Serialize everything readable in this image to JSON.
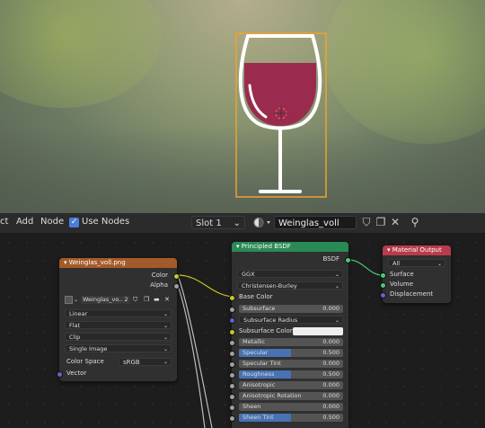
{
  "header": {
    "menu": [
      "ct",
      "Add",
      "Node"
    ],
    "use_nodes_label": "Use Nodes",
    "use_nodes_checked": true,
    "slot_label": "Slot 1",
    "material_name": "Weinglas_voll",
    "icons": [
      "shield-icon",
      "duplicate-icon",
      "close-icon",
      "pin-icon"
    ]
  },
  "image_node": {
    "title": "Weinglas_voll.png",
    "outputs": [
      "Color",
      "Alpha"
    ],
    "image_name": "Weinglas_vo...",
    "users_count": "2",
    "interpolation": "Linear",
    "projection": "Flat",
    "extension": "Clip",
    "source": "Single Image",
    "color_space_label": "Color Space",
    "color_space_value": "sRGB",
    "input_vector": "Vector",
    "header_color": "#a55a2a"
  },
  "bsdf_node": {
    "title": "Principled BSDF",
    "output": "BSDF",
    "distribution": "GGX",
    "subsurface_method": "Christensen-Burley",
    "base_color_label": "Base Color",
    "subsurface_label": "Subsurface",
    "subsurface_value": "0.000",
    "subsurface_radius_label": "Subsurface Radius",
    "subsurface_color_label": "Subsurface Color",
    "fields": [
      {
        "label": "Metallic",
        "value": "0.000",
        "fill": 0
      },
      {
        "label": "Specular",
        "value": "0.500",
        "fill": 0.5
      },
      {
        "label": "Specular Tint",
        "value": "0.000",
        "fill": 0
      },
      {
        "label": "Roughness",
        "value": "0.500",
        "fill": 0.5
      },
      {
        "label": "Anisotropic",
        "value": "0.000",
        "fill": 0
      },
      {
        "label": "Anisotropic Rotation",
        "value": "0.000",
        "fill": 0
      },
      {
        "label": "Sheen",
        "value": "0.000",
        "fill": 0
      },
      {
        "label": "Sheen Tint",
        "value": "0.500",
        "fill": 0.5
      }
    ],
    "header_color": "#2a8a55"
  },
  "output_node": {
    "title": "Material Output",
    "target": "All",
    "inputs": [
      "Surface",
      "Volume",
      "Displacement"
    ],
    "header_color": "#b83c4c"
  },
  "colors": {
    "wine": "#9a2b4f",
    "selection": "#f0a030",
    "accent_blue": "#4772b3"
  }
}
